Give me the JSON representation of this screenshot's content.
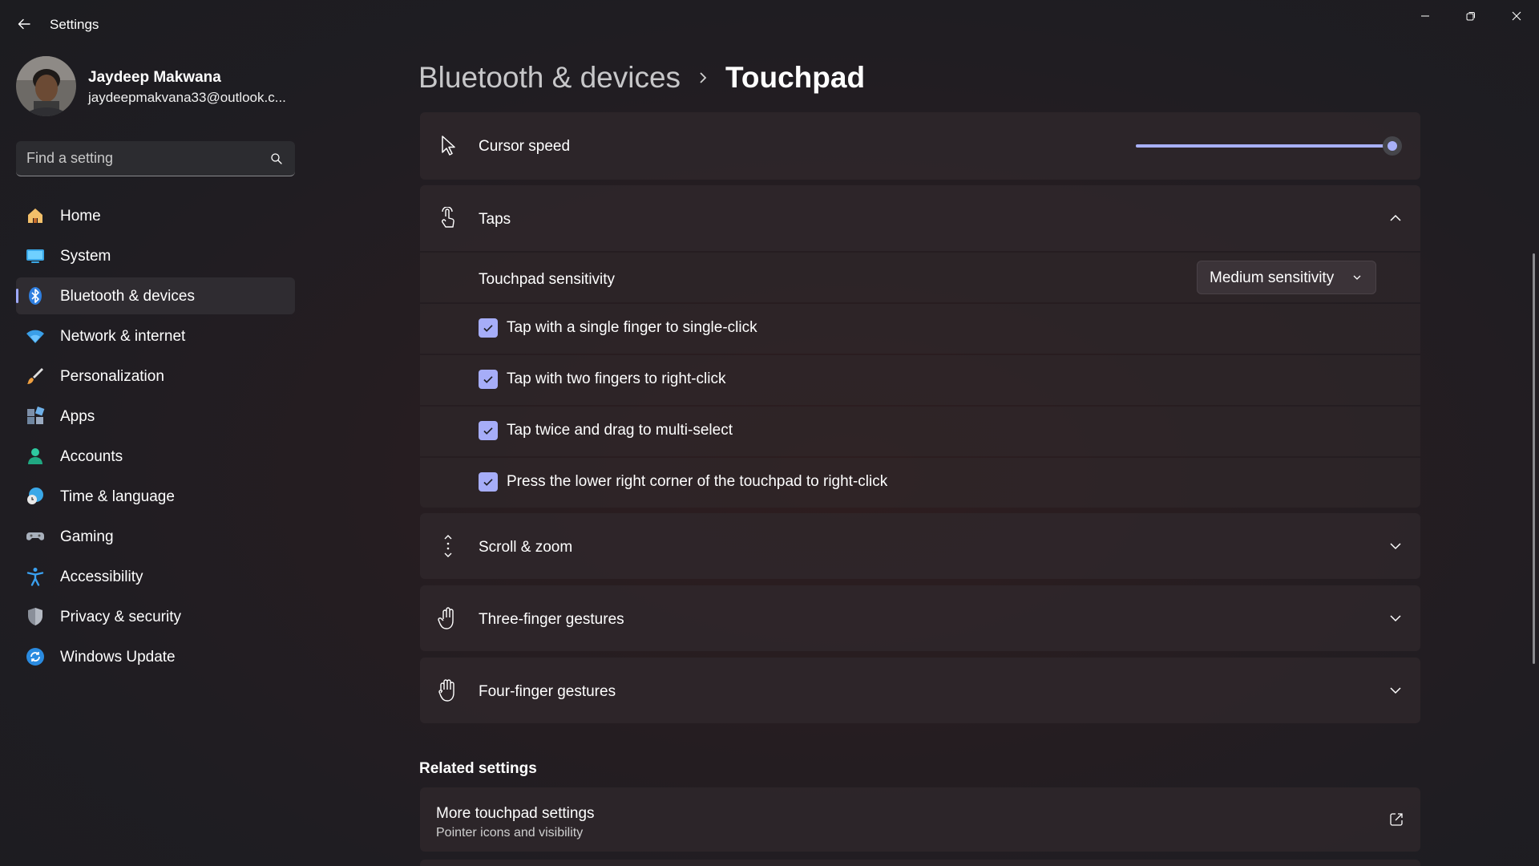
{
  "window": {
    "title": "Settings",
    "controls": [
      "minimize",
      "maximize",
      "close"
    ]
  },
  "profile": {
    "name": "Jaydeep Makwana",
    "email": "jaydeepmakvana33@outlook.c..."
  },
  "search": {
    "placeholder": "Find a setting",
    "value": ""
  },
  "sidebar": {
    "items": [
      {
        "label": "Home",
        "icon": "home-icon",
        "active": false
      },
      {
        "label": "System",
        "icon": "system-icon",
        "active": false
      },
      {
        "label": "Bluetooth & devices",
        "icon": "bluetooth-icon",
        "active": true
      },
      {
        "label": "Network & internet",
        "icon": "wifi-icon",
        "active": false
      },
      {
        "label": "Personalization",
        "icon": "brush-icon",
        "active": false
      },
      {
        "label": "Apps",
        "icon": "apps-icon",
        "active": false
      },
      {
        "label": "Accounts",
        "icon": "accounts-icon",
        "active": false
      },
      {
        "label": "Time & language",
        "icon": "time-language-icon",
        "active": false
      },
      {
        "label": "Gaming",
        "icon": "gaming-icon",
        "active": false
      },
      {
        "label": "Accessibility",
        "icon": "accessibility-icon",
        "active": false
      },
      {
        "label": "Privacy & security",
        "icon": "shield-icon",
        "active": false
      },
      {
        "label": "Windows Update",
        "icon": "update-icon",
        "active": false
      }
    ]
  },
  "breadcrumb": {
    "parent": "Bluetooth & devices",
    "current": "Touchpad"
  },
  "cursor_speed": {
    "label": "Cursor speed",
    "value_fraction": 0.97
  },
  "taps": {
    "label": "Taps",
    "expanded": true,
    "sensitivity_label": "Touchpad sensitivity",
    "sensitivity_value": "Medium sensitivity",
    "options": [
      {
        "label": "Tap with a single finger to single-click",
        "checked": true
      },
      {
        "label": "Tap with two fingers to right-click",
        "checked": true
      },
      {
        "label": "Tap twice and drag to multi-select",
        "checked": true
      },
      {
        "label": "Press the lower right corner of the touchpad to right-click",
        "checked": true
      }
    ]
  },
  "sections": [
    {
      "label": "Scroll & zoom",
      "icon": "scroll-zoom-icon",
      "expanded": false
    },
    {
      "label": "Three-finger gestures",
      "icon": "three-finger-icon",
      "expanded": false
    },
    {
      "label": "Four-finger gestures",
      "icon": "four-finger-icon",
      "expanded": false
    }
  ],
  "related": {
    "heading": "Related settings",
    "items": [
      {
        "title": "More touchpad settings",
        "subtitle": "Pointer icons and visibility",
        "icon": "external-link-icon"
      }
    ]
  },
  "colors": {
    "accent": "#a8b0f8",
    "background": "#201d21",
    "card": "#30282b"
  }
}
